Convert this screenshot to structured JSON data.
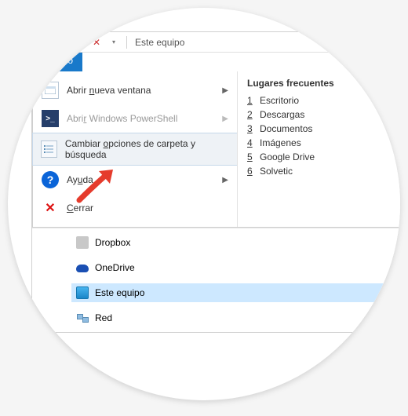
{
  "qat": {
    "title": "Este equipo"
  },
  "tabs": {
    "file": "Archivo"
  },
  "menu": {
    "new_window": "Abrir nueva ventana",
    "powershell": "Abrir Windows PowerShell",
    "folder_options": "Cambiar opciones de carpeta y búsqueda",
    "help": "Ayuda",
    "close": "Cerrar"
  },
  "frequent": {
    "heading": "Lugares frecuentes",
    "items": [
      {
        "n": "1",
        "label": "Escritorio"
      },
      {
        "n": "2",
        "label": "Descargas"
      },
      {
        "n": "3",
        "label": "Documentos"
      },
      {
        "n": "4",
        "label": "Imágenes"
      },
      {
        "n": "5",
        "label": "Google Drive"
      },
      {
        "n": "6",
        "label": "Solvetic"
      }
    ]
  },
  "tree": {
    "dropbox": "Dropbox",
    "onedrive": "OneDrive",
    "thispc": "Este equipo",
    "network": "Red"
  }
}
